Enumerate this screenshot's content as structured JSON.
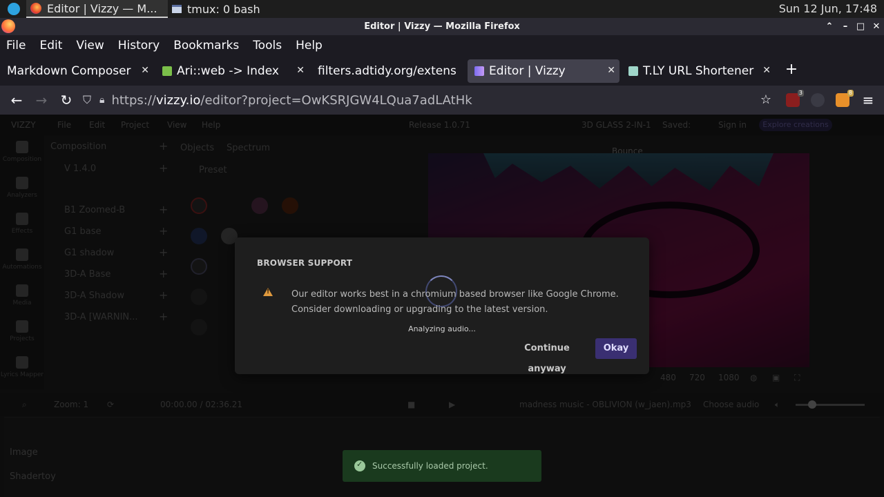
{
  "os": {
    "active_window": "Editor | Vizzy — M...",
    "inactive_window": "tmux: 0 bash",
    "clock": "Sun 12 Jun, 17:48"
  },
  "browser": {
    "title": "Editor | Vizzy — Mozilla Firefox",
    "menu": [
      "File",
      "Edit",
      "View",
      "History",
      "Bookmarks",
      "Tools",
      "Help"
    ],
    "tabs": [
      {
        "label": "Markdown Composer"
      },
      {
        "label": "Ari::web -> Index"
      },
      {
        "label": "filters.adtidy.org/extens"
      },
      {
        "label": "Editor | Vizzy"
      },
      {
        "label": "T.LY URL Shortener"
      }
    ],
    "url_prefix": "https://",
    "url_host": "vizzy.io",
    "url_path": "/editor?project=OwKSRJGW4LQua7adLAtHk",
    "ext_badge_1": "3",
    "ext_badge_2": "8"
  },
  "app": {
    "brand": "VIZZY",
    "menu": [
      "File",
      "Edit",
      "Project",
      "View",
      "Help"
    ],
    "release": "Release 1.0.71",
    "preset_name": "3D GLASS 2-IN-1",
    "saved_label": "Saved:",
    "sign_in": "Sign in",
    "explore": "Explore creations",
    "rail": [
      "Composition",
      "Analyzers",
      "Effects",
      "Automations",
      "Media",
      "Projects",
      "Lyrics Mapper"
    ],
    "composition_title": "Composition",
    "composition_rows": [
      "V 1.4.0",
      "B1 Zoomed-B",
      "G1 base",
      "G1 shadow",
      "3D-A Base",
      "3D-A Shadow",
      "3D-A [WARNIN..."
    ],
    "objects_title": "Objects",
    "objects_sub": "Spectrum",
    "preset_label": "Preset",
    "bounce_label": "Bounce",
    "resolutions": [
      "480",
      "720",
      "1080"
    ],
    "zoom_label": "Zoom: 1",
    "time": "00:00.00 / 02:36.21",
    "track": "madness music - OBLIVION (w_jaen).mp3",
    "choose_audio": "Choose audio",
    "timeline_labels": [
      "Image",
      "Shadertoy"
    ]
  },
  "modal": {
    "title": "BROWSER SUPPORT",
    "line1": "Our editor works best in a chromium based browser like Google Chrome.",
    "line2": "Consider downloading or upgrading to the latest version.",
    "analyzing": "Analyzing audio...",
    "continue": "Continue anyway",
    "okay": "Okay"
  },
  "toast": {
    "message": "Successfully loaded project."
  }
}
